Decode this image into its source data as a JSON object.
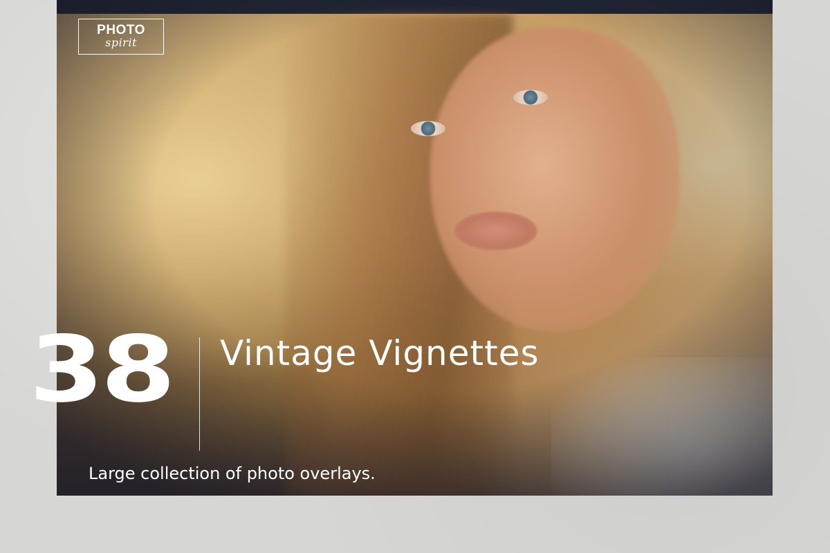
{
  "logo": {
    "line1": "PHOTO",
    "line2": "spirit"
  },
  "headline": {
    "count": "38",
    "title": "Vintage Vignettes"
  },
  "subtitle": "Large collection of photo overlays.",
  "colors": {
    "page_background": "#d6d6d4",
    "frame": "#1f2433",
    "text": "#ffffff"
  }
}
